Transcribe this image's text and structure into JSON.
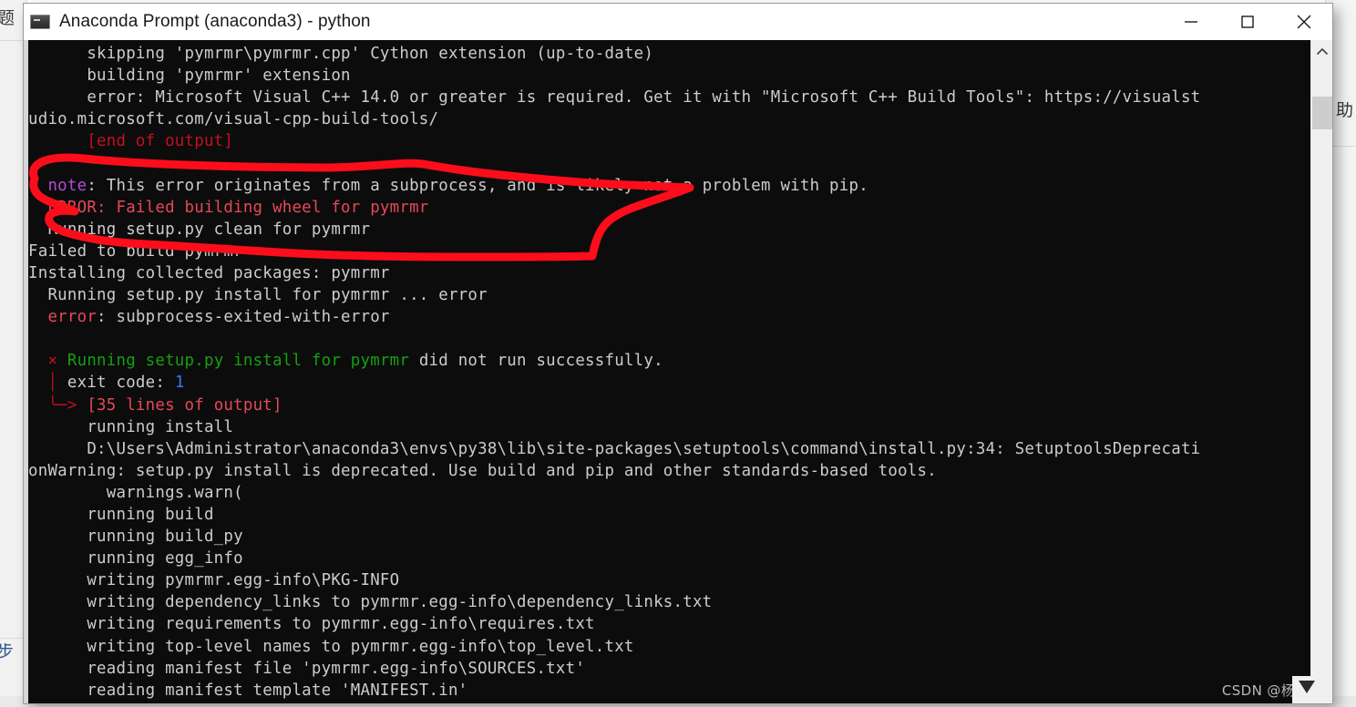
{
  "window": {
    "title": "Anaconda Prompt (anaconda3) - python",
    "icon": "console-icon",
    "minimize_label": "—",
    "maximize_label": "□",
    "close_label": "✕"
  },
  "scrollbar": {
    "up_arrow": "˄",
    "thumb_label": "scroll-thumb"
  },
  "terminal": {
    "lines": [
      {
        "indent": 0,
        "segments": [
          {
            "text": "      skipping 'pymrmr\\pymrmr.cpp' Cython extension (up-to-date)",
            "color": "white"
          }
        ]
      },
      {
        "indent": 0,
        "segments": [
          {
            "text": "      building 'pymrmr' extension",
            "color": "white"
          }
        ]
      },
      {
        "indent": 0,
        "segments": [
          {
            "text": "      error: Microsoft Visual C++ 14.0 or greater is required. Get it with \"Microsoft C++ Build Tools\": https://visualst",
            "color": "white"
          }
        ]
      },
      {
        "indent": 0,
        "segments": [
          {
            "text": "udio.microsoft.com/visual-cpp-build-tools/",
            "color": "white"
          }
        ]
      },
      {
        "indent": 0,
        "segments": [
          {
            "text": "      [end of output]",
            "color": "red"
          }
        ]
      },
      {
        "indent": 0,
        "segments": [
          {
            "text": "",
            "color": "white"
          }
        ]
      },
      {
        "indent": 0,
        "segments": [
          {
            "text": "  note",
            "color": "magenta"
          },
          {
            "text": ": This error originates from a subprocess, and is likely not a problem with pip.",
            "color": "white"
          }
        ]
      },
      {
        "indent": 0,
        "segments": [
          {
            "text": "  ERROR: Failed building wheel for pymrmr",
            "color": "brred"
          }
        ]
      },
      {
        "indent": 0,
        "segments": [
          {
            "text": "  Running setup.py clean for pymrmr",
            "color": "white"
          }
        ]
      },
      {
        "indent": 0,
        "segments": [
          {
            "text": "Failed to build pymrmr",
            "color": "white"
          }
        ]
      },
      {
        "indent": 0,
        "segments": [
          {
            "text": "Installing collected packages: pymrmr",
            "color": "white"
          }
        ]
      },
      {
        "indent": 0,
        "segments": [
          {
            "text": "  Running setup.py install for pymrmr ... error",
            "color": "white"
          }
        ]
      },
      {
        "indent": 0,
        "segments": [
          {
            "text": "  error",
            "color": "brred"
          },
          {
            "text": ": subprocess-exited-with-error",
            "color": "white"
          }
        ]
      },
      {
        "indent": 0,
        "segments": [
          {
            "text": "",
            "color": "white"
          }
        ]
      },
      {
        "indent": 0,
        "segments": [
          {
            "text": "  × ",
            "color": "red"
          },
          {
            "text": "Running setup.py install for pymrmr",
            "color": "green"
          },
          {
            "text": " did not run successfully.",
            "color": "white"
          }
        ]
      },
      {
        "indent": 0,
        "segments": [
          {
            "text": "  │ ",
            "color": "red"
          },
          {
            "text": "exit code: ",
            "color": "white"
          },
          {
            "text": "1",
            "color": "blue"
          }
        ]
      },
      {
        "indent": 0,
        "segments": [
          {
            "text": "  ╰─> ",
            "color": "red"
          },
          {
            "text": "[35 lines of output]",
            "color": "brred"
          }
        ]
      },
      {
        "indent": 0,
        "segments": [
          {
            "text": "      running install",
            "color": "white"
          }
        ]
      },
      {
        "indent": 0,
        "segments": [
          {
            "text": "      D:\\Users\\Administrator\\anaconda3\\envs\\py38\\lib\\site-packages\\setuptools\\command\\install.py:34: SetuptoolsDeprecati",
            "color": "white"
          }
        ]
      },
      {
        "indent": 0,
        "segments": [
          {
            "text": "onWarning: setup.py install is deprecated. Use build and pip and other standards-based tools.",
            "color": "white"
          }
        ]
      },
      {
        "indent": 0,
        "segments": [
          {
            "text": "        warnings.warn(",
            "color": "white"
          }
        ]
      },
      {
        "indent": 0,
        "segments": [
          {
            "text": "      running build",
            "color": "white"
          }
        ]
      },
      {
        "indent": 0,
        "segments": [
          {
            "text": "      running build_py",
            "color": "white"
          }
        ]
      },
      {
        "indent": 0,
        "segments": [
          {
            "text": "      running egg_info",
            "color": "white"
          }
        ]
      },
      {
        "indent": 0,
        "segments": [
          {
            "text": "      writing pymrmr.egg-info\\PKG-INFO",
            "color": "white"
          }
        ]
      },
      {
        "indent": 0,
        "segments": [
          {
            "text": "      writing dependency_links to pymrmr.egg-info\\dependency_links.txt",
            "color": "white"
          }
        ]
      },
      {
        "indent": 0,
        "segments": [
          {
            "text": "      writing requirements to pymrmr.egg-info\\requires.txt",
            "color": "white"
          }
        ]
      },
      {
        "indent": 0,
        "segments": [
          {
            "text": "      writing top-level names to pymrmr.egg-info\\top_level.txt",
            "color": "white"
          }
        ]
      },
      {
        "indent": 0,
        "segments": [
          {
            "text": "      reading manifest file 'pymrmr.egg-info\\SOURCES.txt'",
            "color": "white"
          }
        ]
      },
      {
        "indent": 0,
        "segments": [
          {
            "text": "      reading manifest template 'MANIFEST.in'",
            "color": "white"
          }
        ]
      }
    ]
  },
  "annotation": {
    "color": "#fc0d1b",
    "shape": "hand-drawn-red-ellipse",
    "stroke_width": 9
  },
  "background": {
    "cjk_top_left": "题",
    "cjk_bottom_left": "步",
    "cjk_mid_right": "助"
  },
  "watermark": {
    "text": "CSDN @杨笃笃"
  },
  "colors": {
    "terminal_bg": "#0c0c0c",
    "terminal_fg": "#cccccc",
    "red": "#c50f1f",
    "bright_red": "#e74856",
    "green": "#13a10e",
    "magenta": "#b14bd8",
    "blue": "#3b78ff",
    "annotation_red": "#fc0d1b"
  }
}
